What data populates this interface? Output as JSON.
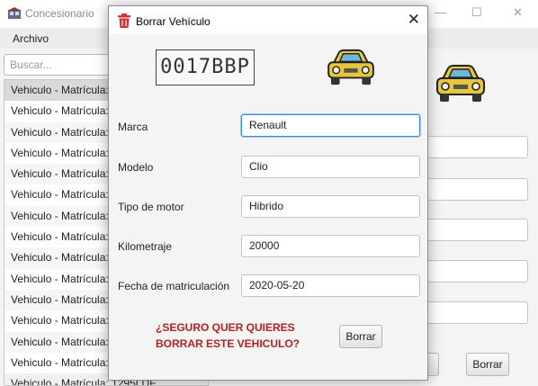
{
  "app": {
    "title": "Concesionario",
    "menu": [
      "Archivo"
    ],
    "search_placeholder": "Buscar...",
    "list_items": [
      "Vehiculo - Matrícula: 0017BBP",
      "Vehiculo - Matrícula: 0234KLM",
      "Vehiculo - Matrícula: 0812FGH",
      "Vehiculo - Matrícula: 1020BCD",
      "Vehiculo - Matrícula: 1145JKL",
      "Vehiculo - Matrícula: 1189MNP",
      "Vehiculo - Matrícula: 1201QRS",
      "Vehiculo - Matrícula: 1222TVW",
      "Vehiculo - Matrícula: 1234XYZ",
      "Vehiculo - Matrícula: 1250BBC",
      "Vehiculo - Matrícula: 1266DDF",
      "Vehiculo - Matrícula: 1271GGH",
      "Vehiculo - Matrícula: 1288JJK",
      "Vehiculo - Matrícula: 1290LLM",
      "Vehiculo - Matrícula: 1295LDF"
    ],
    "background_buttons": [
      "Borrar"
    ]
  },
  "dialog": {
    "title": "Borrar Vehículo",
    "plate": "0017BBP",
    "fields": [
      {
        "label": "Marca",
        "value": "Renault"
      },
      {
        "label": "Modelo",
        "value": "Clio"
      },
      {
        "label": "Tipo de motor",
        "value": "Hibrido"
      },
      {
        "label": "Kilometraje",
        "value": "20000"
      },
      {
        "label": "Fecha de matriculación",
        "value": "2020-05-20"
      }
    ],
    "warning_line1": "¿SEGURO QUER QUIERES",
    "warning_line2": "BORRAR ESTE VEHICULO?",
    "confirm_button": "Borrar"
  },
  "colors": {
    "warning": "#b22222",
    "focus": "#3a8fd6",
    "car_body": "#e8c83a"
  },
  "icons": [
    "app-icon",
    "trash-icon",
    "close-icon",
    "car-icon"
  ]
}
